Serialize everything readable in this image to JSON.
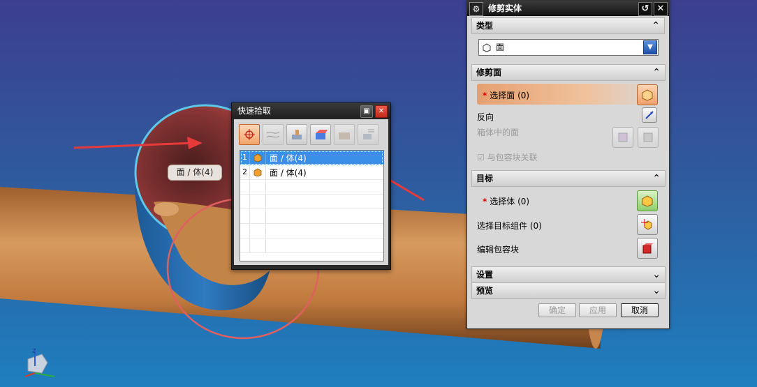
{
  "quick_pick": {
    "title": "快速拾取",
    "items": [
      {
        "num": "1",
        "text": "面 / 体(4)",
        "selected": true
      },
      {
        "num": "2",
        "text": "面 / 体(4)",
        "selected": false
      }
    ]
  },
  "tooltip": "面 / 体(4)",
  "panel": {
    "title": "修剪实体",
    "type_section": {
      "header": "类型",
      "combo_value": "面"
    },
    "trim_face_section": {
      "header": "修剪面",
      "select_face": "选择面 (0)",
      "reverse": "反向",
      "faces_in_box": "箱体中的面",
      "associate": "与包容块关联"
    },
    "target_section": {
      "header": "目标",
      "select_body": "选择体 (0)",
      "select_component": "选择目标组件 (0)",
      "edit_box": "编辑包容块"
    },
    "settings_header": "设置",
    "preview_header": "预览",
    "buttons": {
      "ok": "确定",
      "apply": "应用",
      "cancel": "取消"
    }
  },
  "colors": {
    "accent_orange": "#f0a06b",
    "selection_blue": "#3a8fe6",
    "viewport_top": "#3c3f8e",
    "viewport_bottom": "#1e7fbf"
  }
}
